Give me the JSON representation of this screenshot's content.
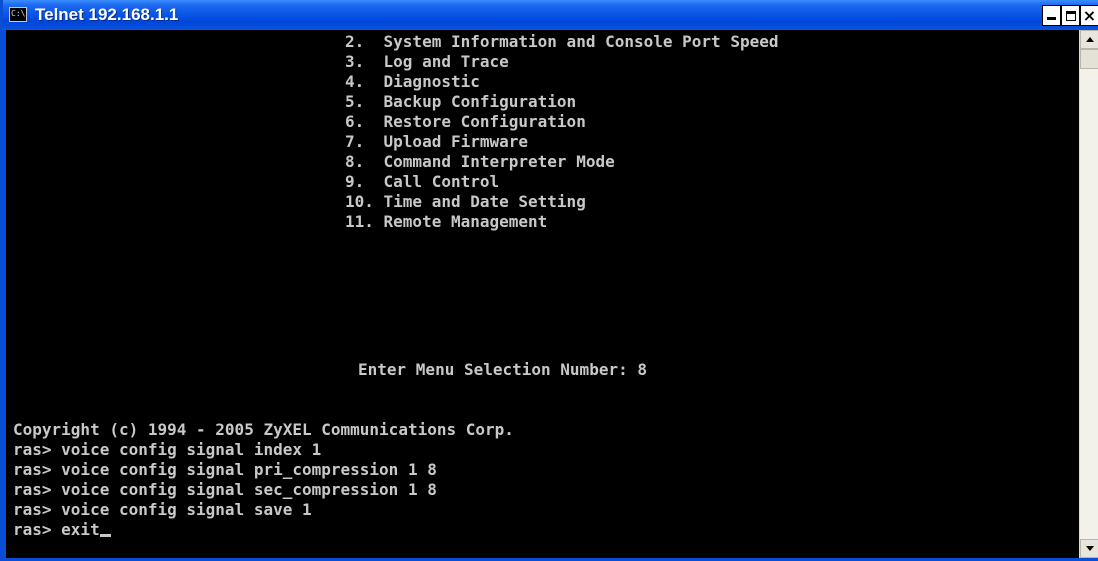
{
  "window": {
    "title": "Telnet 192.168.1.1",
    "icon_label": "C:\\",
    "buttons": {
      "minimize": "minimize",
      "maximize": "maximize",
      "close": "×"
    }
  },
  "console": {
    "menu_items": [
      "2.  System Information and Console Port Speed",
      "3.  Log and Trace",
      "4.  Diagnostic",
      "5.  Backup Configuration",
      "6.  Restore Configuration",
      "7.  Upload Firmware",
      "8.  Command Interpreter Mode",
      "9.  Call Control",
      "10. Time and Date Setting",
      "11. Remote Management"
    ],
    "prompt": "Enter Menu Selection Number: 8",
    "log_lines": [
      "Copyright (c) 1994 - 2005 ZyXEL Communications Corp.",
      "ras> voice config signal index 1",
      "ras> voice config signal pri_compression 1 8",
      "ras> voice config signal sec_compression 1 8",
      "ras> voice config signal save 1"
    ],
    "current_line": "ras> exit"
  },
  "colors": {
    "titlebar": "#0a58e8",
    "console_bg": "#000000",
    "console_text": "#c8c8c8"
  },
  "icons": {
    "window": "console-icon",
    "scroll_up": "up-arrow-icon",
    "scroll_down": "down-arrow-icon"
  }
}
